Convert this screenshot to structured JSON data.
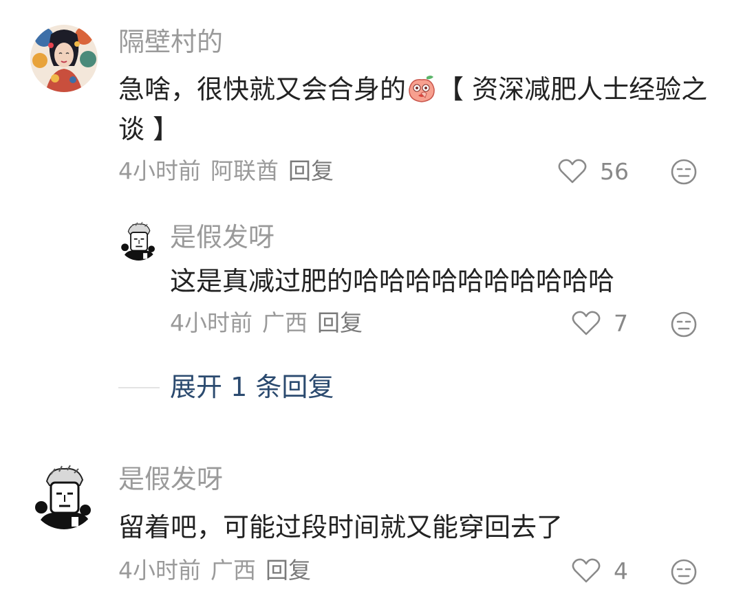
{
  "comments": [
    {
      "username": "隔壁村的",
      "text_before_emoji": "急啥，很快就又会合身的",
      "emoji": "peach-emoji",
      "text_after_emoji": "【 资深减肥人士经验之谈 】",
      "time": "4小时前",
      "location": "阿联酋",
      "reply_label": "回复",
      "likes": "56"
    },
    {
      "username": "是假发呀",
      "text": "这是真减过肥的哈哈哈哈哈哈哈哈哈哈",
      "time": "4小时前",
      "location": "广西",
      "reply_label": "回复",
      "likes": "7"
    },
    {
      "username": "是假发呀",
      "text": "留着吧，可能过段时间就又能穿回去了",
      "time": "4小时前",
      "location": "广西",
      "reply_label": "回复",
      "likes": "4"
    }
  ],
  "expand": {
    "label": "展开 1 条回复"
  },
  "colors": {
    "username": "#9a9a9a",
    "body_text": "#222222",
    "meta": "#9a9a9a",
    "expand_link": "#2b4a6f"
  },
  "icons": {
    "like": "heart-outline-icon",
    "dislike": "meh-face-icon"
  }
}
